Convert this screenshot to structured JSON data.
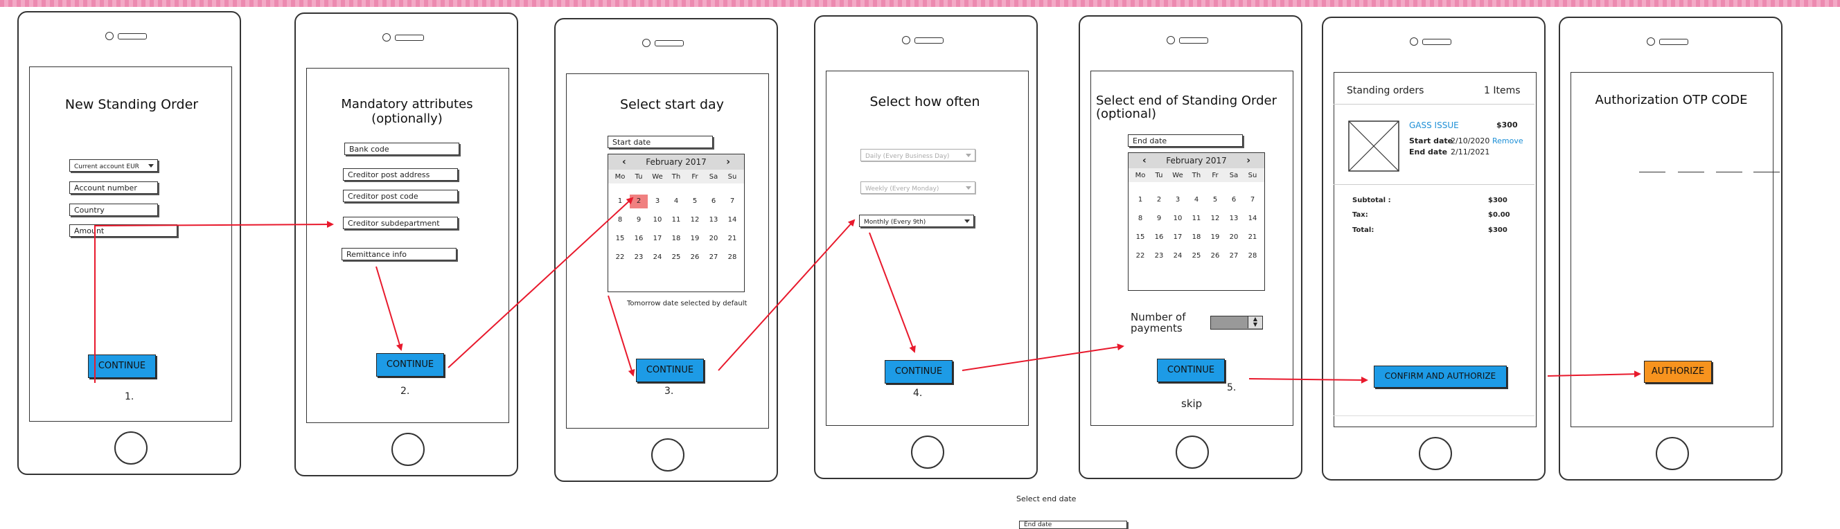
{
  "screens": {
    "s1": {
      "title": "New Standing Order",
      "fields": [
        "Current account EUR",
        "Account number",
        "Country",
        "Amount"
      ],
      "button": "CONTINUE",
      "step": "1."
    },
    "s2": {
      "title": "Mandatory attributes (optionally)",
      "fields": [
        "Bank code",
        "Creditor post address",
        "Creditor post code",
        "Creditor subdepartment",
        "Remittance info"
      ],
      "button": "CONTINUE",
      "step": "2."
    },
    "s3": {
      "title": "Select start day",
      "date_field": "Start date",
      "calendar": {
        "month": "February 2017",
        "weekdays": [
          "Mo",
          "Tu",
          "We",
          "Th",
          "Fr",
          "Sa",
          "Su"
        ],
        "rows": [
          [
            "1",
            "2",
            "3",
            "4",
            "5",
            "6",
            "7"
          ],
          [
            "8",
            "9",
            "10",
            "11",
            "12",
            "13",
            "14"
          ],
          [
            "15",
            "16",
            "17",
            "18",
            "19",
            "20",
            "21"
          ],
          [
            "22",
            "23",
            "24",
            "25",
            "26",
            "27",
            "28"
          ]
        ],
        "selected": "2"
      },
      "note": "Tomorrow date selected by default",
      "button": "CONTINUE",
      "step": "3."
    },
    "s4": {
      "title": "Select how often",
      "options": [
        "Daily (Every Business Day)",
        "Weekly (Every Monday)",
        "Monthly (Every 9th)"
      ],
      "button": "CONTINUE",
      "step": "4."
    },
    "s5": {
      "title": "Select end of Standing Order (optional)",
      "date_field": "End date",
      "calendar": {
        "month": "February 2017",
        "weekdays": [
          "Mo",
          "Tu",
          "We",
          "Th",
          "Fr",
          "Sa",
          "Su"
        ],
        "rows": [
          [
            "1",
            "2",
            "3",
            "4",
            "5",
            "6",
            "7"
          ],
          [
            "8",
            "9",
            "10",
            "11",
            "12",
            "13",
            "14"
          ],
          [
            "15",
            "16",
            "17",
            "18",
            "19",
            "20",
            "21"
          ],
          [
            "22",
            "23",
            "24",
            "25",
            "26",
            "27",
            "28"
          ]
        ]
      },
      "payments_label": "Number of payments",
      "button": "CONTINUE",
      "skip": "skip",
      "step": "5."
    },
    "s6": {
      "header_title": "Standing orders",
      "header_count": "1 Items",
      "item_name": "GASS ISSUE",
      "item_price": "$300",
      "start_label": "Start date",
      "start_value": "2/10/2020",
      "remove": "Remove",
      "end_label": "End date",
      "end_value": "2/11/2021",
      "subtotal_label": "Subtotal :",
      "subtotal_value": "$300",
      "tax_label": "Tax:",
      "tax_value": "$0.00",
      "total_label": "Total:",
      "total_value": "$300",
      "button": "CONFIRM AND AUTHORIZE"
    },
    "s7": {
      "title": "Authorization OTP CODE",
      "button": "AUTHORIZE"
    }
  },
  "below": {
    "label": "Select end date",
    "field": "End date"
  },
  "colors": {
    "button_blue": "#1d9be6",
    "button_orange": "#f7931e",
    "arrow_red": "#e8192c",
    "selected_day": "#f08080",
    "link_blue": "#1d8fd6"
  }
}
